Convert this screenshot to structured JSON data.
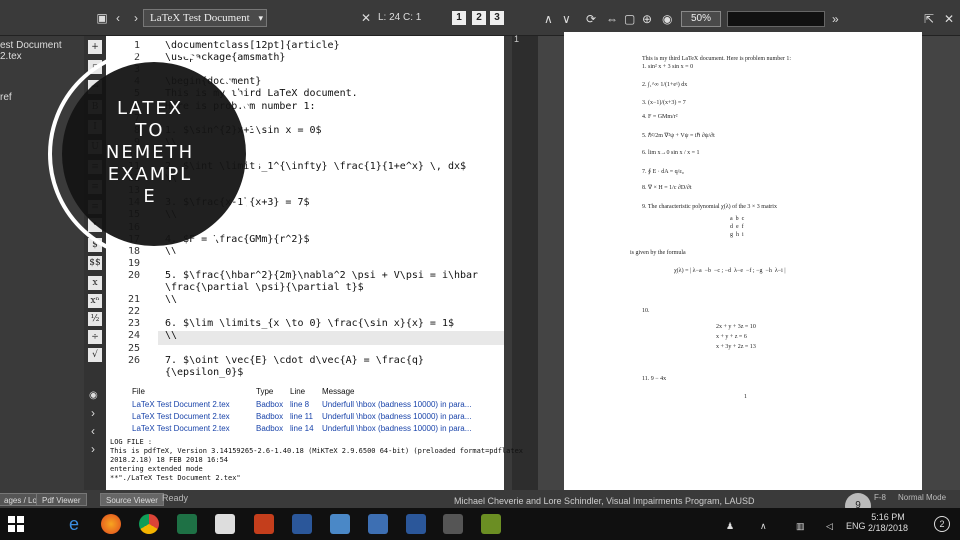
{
  "toolbar": {
    "doc_select": "LaTeX Test Document",
    "line_col": "L: 24 C: 1",
    "view_nums": [
      "1",
      "2",
      "3"
    ],
    "zoom": "50%"
  },
  "structure": {
    "item_1": "est Document 2.tex",
    "item_2": "ref"
  },
  "editor": {
    "line_numbers": [
      "1",
      "2",
      "3",
      "4",
      "5",
      "6",
      "7",
      "8",
      "9",
      "10",
      "11",
      "12",
      "13",
      "14",
      "15",
      "16",
      "17",
      "18",
      "19",
      "20",
      "",
      "21",
      "22",
      "23",
      "24",
      "25",
      "26",
      ""
    ],
    "code_lines": [
      "\\documentclass[12pt]{article}",
      "\\usepackage{amsmath}",
      "",
      "\\begin{document}",
      "This is my third LaTeX document.",
      "Here is prob.em number 1:",
      "",
      "1. $\\sin^{2}x+3\\sin x = 0$",
      "\\\\",
      "",
      "2. $\\int \\limits_1^{\\infty} \\frac{1}{1+e^x} \\, dx$",
      "\\\\",
      "",
      "3. $\\frac{x-1}{x+3} = 7$",
      "\\\\",
      "",
      "4. $F = \\frac{GMm}{r^2}$",
      "\\\\",
      "",
      "5. $\\frac{\\hbar^2}{2m}\\nabla^2 \\psi + V\\psi = i\\hbar",
      "\\frac{\\partial \\psi}{\\partial t}$",
      "\\\\",
      "",
      "6. $\\lim \\limits_{x \\to 0} \\frac{\\sin x}{x} = 1$",
      "\\\\",
      "",
      "7. $\\oint \\vec{E} \\cdot d\\vec{A} = \\frac{q}",
      "{\\epsilon_0}$"
    ]
  },
  "overlay": {
    "lines": [
      "LATEX",
      "TO",
      "NEMETH",
      "EXAMPL",
      "E"
    ]
  },
  "pdf": {
    "lines": [
      "This is my third LaTeX document. Here is problem number 1:",
      "1. sin² x + 3 sin x = 0",
      "2. ∫₁^∞ 1/(1+eˣ) dx",
      "3. (x−1)/(x+3) = 7",
      "4. F = GMm/r²",
      "5. ℏ²/2m ∇²ψ + Vψ = iℏ ∂ψ/∂t",
      "6. lim x→0 sin x / x = 1",
      "7. ∮ E · dA = q/ε₀",
      "8. ∇ × H = 1/c ∂D/∂t",
      "9. The characteristic polynomial χ(λ) of the 3 × 3 matrix",
      "a  b  c",
      "d  e  f",
      "g  h  i",
      "is given by the formula",
      "χ(λ) = | λ−a  −b  −c ; −d  λ−e  −f ; −g  −h  λ−i |",
      "10.",
      "2x + y + 3z = 10",
      "x + y + z = 6",
      "x + 3y + 2z = 13",
      "11. 9 − 4x",
      "1"
    ]
  },
  "log": {
    "headers": [
      "File",
      "Type",
      "Line",
      "Message"
    ],
    "rows": [
      [
        "LaTeX Test Document 2.tex",
        "Badbox",
        "line 8",
        "Underfull \\hbox (badness 10000) in para..."
      ],
      [
        "LaTeX Test Document 2.tex",
        "Badbox",
        "line 11",
        "Underfull \\hbox (badness 10000) in para..."
      ],
      [
        "LaTeX Test Document 2.tex",
        "Badbox",
        "line 14",
        "Underfull \\hbox (badness 10000) in para..."
      ]
    ],
    "text_lines": [
      "LOG FILE :",
      "This is pdfTeX, Version 3.14159265-2.6-1.40.18 (MiKTeX 2.9.6500 64-bit) (preloaded format=pdflatex",
      "2018.2.18) 18 FEB 2018 16:54",
      "entering extended mode",
      "**\"./LaTeX Test Document 2.tex\""
    ]
  },
  "statusbar": {
    "messages_log": "ages / Log",
    "pdf_viewer": "Pdf Viewer",
    "source_viewer": "Source Viewer",
    "ready": "Ready",
    "normal_mode": "Normal Mode",
    "encoding": "F-8"
  },
  "footer": {
    "credit": "Michael Cheverie and Lore Schindler, Visual Impairments Program, LAUSD",
    "slide_number": "9"
  },
  "taskbar": {
    "lang": "ENG",
    "time": "5:16 PM",
    "date": "2/18/2018",
    "notification_count": "2"
  },
  "colors": {
    "editor_bg": "#ffffff",
    "panel_bg": "#3a3a3a",
    "log_link": "#1a44aa"
  }
}
